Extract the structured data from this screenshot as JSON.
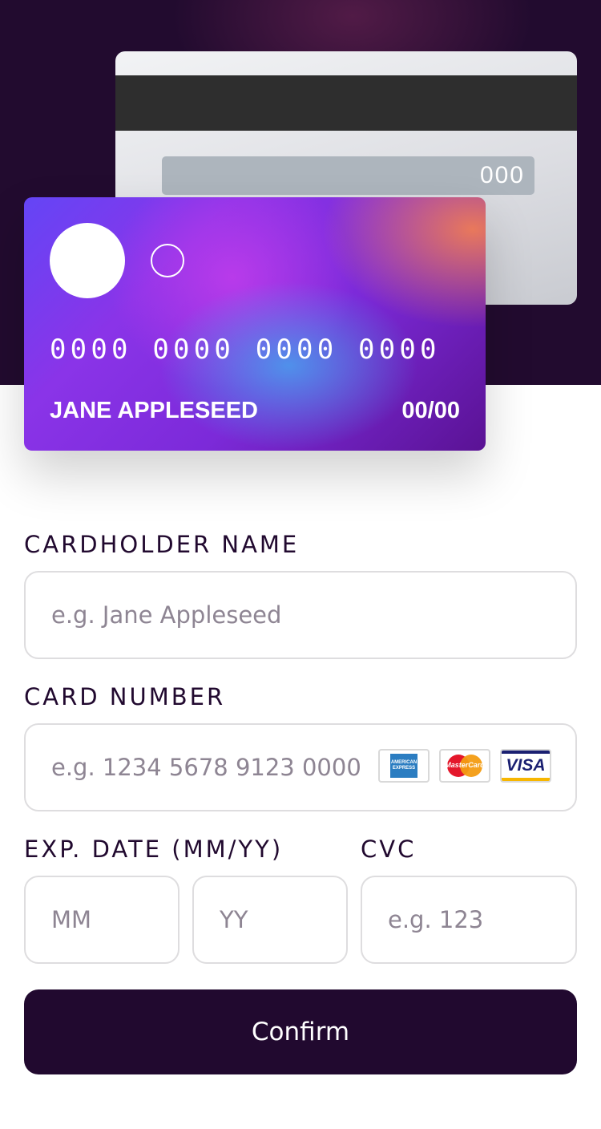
{
  "card_back": {
    "cvc": "000"
  },
  "card_front": {
    "number": "0000 0000 0000 0000",
    "holder": "JANE APPLESEED",
    "expiry": "00/00"
  },
  "form": {
    "cardholder_label": "CARDHOLDER NAME",
    "cardholder_placeholder": "e.g. Jane Appleseed",
    "number_label": "CARD NUMBER",
    "number_placeholder": "e.g. 1234 5678 9123 0000",
    "expiry_label": "EXP. DATE (MM/YY)",
    "month_placeholder": "MM",
    "year_placeholder": "YY",
    "cvc_label": "CVC",
    "cvc_placeholder": "e.g. 123",
    "brands": [
      "amex-logo",
      "mastercard-logo",
      "visa-logo"
    ],
    "mastercard_text": "MasterCard",
    "visa_text": "VISA",
    "confirm_label": "Confirm"
  },
  "colors": {
    "header_bg": "#220b2f",
    "button_bg": "#21092f",
    "input_border": "#dedddf"
  }
}
